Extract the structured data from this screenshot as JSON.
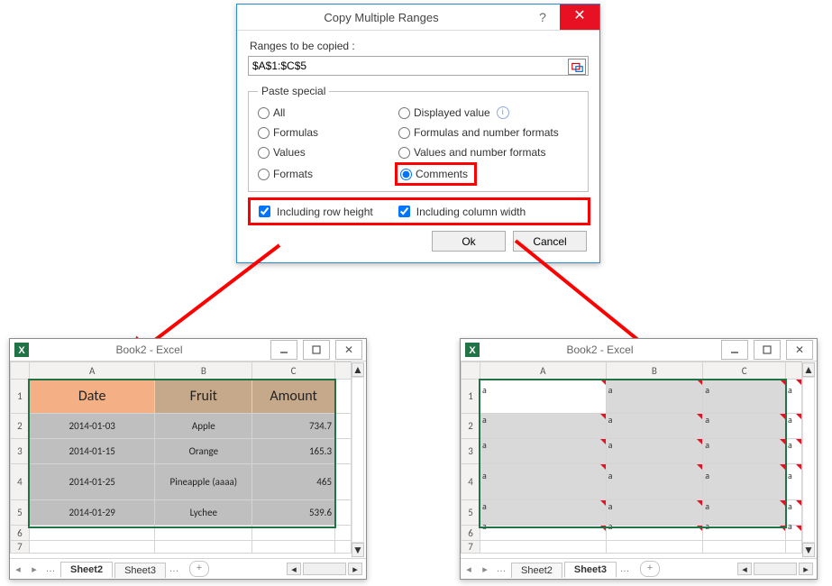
{
  "dialog": {
    "title": "Copy Multiple Ranges",
    "ranges_label": "Ranges to be copied :",
    "ranges_value": "$A$1:$C$5",
    "paste_legend": "Paste special",
    "radio": {
      "all": "All",
      "displayed": "Displayed value",
      "formulas": "Formulas",
      "f_and_nf": "Formulas and number formats",
      "values": "Values",
      "v_and_nf": "Values and number formats",
      "formats": "Formats",
      "comments": "Comments"
    },
    "selected_radio": "comments",
    "chk": {
      "rowh": "Including row height",
      "colw": "Including column width"
    },
    "chk_rowh": true,
    "chk_colw": true,
    "ok": "Ok",
    "cancel": "Cancel"
  },
  "left": {
    "title": "Book2 - Excel",
    "cols": [
      "A",
      "B",
      "C"
    ],
    "header": {
      "date": "Date",
      "fruit": "Fruit",
      "amount": "Amount"
    },
    "rows": [
      {
        "date": "2014-01-03",
        "fruit": "Apple",
        "amount": "734.7"
      },
      {
        "date": "2014-01-15",
        "fruit": "Orange",
        "amount": "165.3"
      },
      {
        "date": "2014-01-25",
        "fruit": "Pineapple (aaaa)",
        "amount": "465"
      },
      {
        "date": "2014-01-29",
        "fruit": "Lychee",
        "amount": "539.6"
      }
    ],
    "tabs": {
      "a": "Sheet2",
      "b": "Sheet3",
      "active": "Sheet2"
    }
  },
  "right": {
    "title": "Book2 - Excel",
    "cols": [
      "A",
      "B",
      "C"
    ],
    "c": "a",
    "tabs": {
      "a": "Sheet2",
      "b": "Sheet3",
      "active": "Sheet3"
    }
  }
}
